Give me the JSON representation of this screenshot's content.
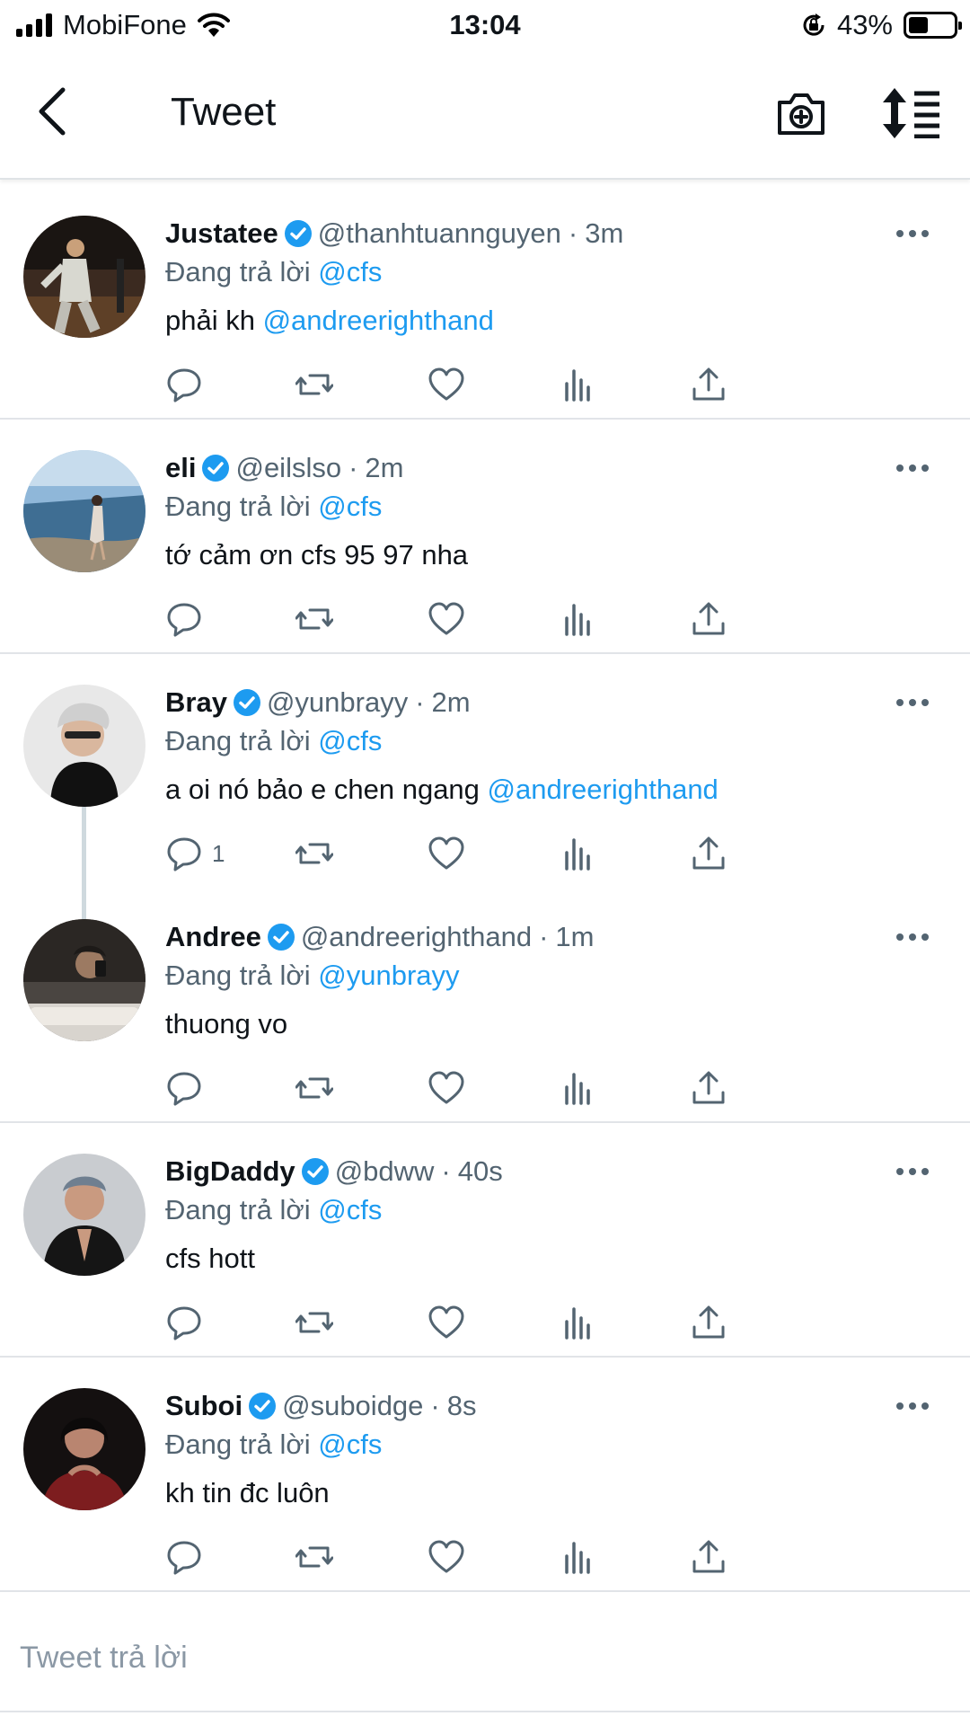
{
  "status_bar": {
    "carrier": "MobiFone",
    "time": "13:04",
    "battery": "43%",
    "battery_level": 0.43
  },
  "nav": {
    "title": "Tweet",
    "icons": {
      "back": "chevron-left-icon",
      "camera": "camera-plus-icon",
      "sort": "sort-icon"
    }
  },
  "colors": {
    "accent": "#1d9bf0",
    "text": "#0f1419",
    "muted": "#536471",
    "divider": "#e1e4e8"
  },
  "tweets": [
    {
      "name": "Justatee",
      "handle": "@thanhtuannguyen",
      "dot": "·",
      "time": "3m",
      "reply_prefix": "Đang trả lời",
      "reply_to": "@cfs",
      "text": "phải kh ",
      "text_mention": "@andreerighthand",
      "reply_count": ""
    },
    {
      "name": "eli",
      "handle": "@eilslso",
      "dot": "·",
      "time": "2m",
      "reply_prefix": "Đang trả lời",
      "reply_to": "@cfs",
      "text": "tớ cảm ơn cfs 95 97 nha",
      "text_mention": "",
      "reply_count": ""
    },
    {
      "name": "Bray",
      "handle": "@yunbrayy",
      "dot": "·",
      "time": "2m",
      "reply_prefix": "Đang trả lời",
      "reply_to": "@cfs",
      "text": "a oi nó bảo e chen ngang ",
      "text_mention": "@andreerighthand",
      "reply_count": "1"
    },
    {
      "name": "Andree",
      "handle": "@andreerighthand",
      "dot": "·",
      "time": "1m",
      "reply_prefix": "Đang trả lời",
      "reply_to": "@yunbrayy",
      "text": "thuong vo",
      "text_mention": "",
      "reply_count": ""
    },
    {
      "name": "BigDaddy",
      "handle": "@bdww",
      "dot": "·",
      "time": "40s",
      "reply_prefix": "Đang trả lời",
      "reply_to": "@cfs",
      "text": "cfs hott",
      "text_mention": "",
      "reply_count": ""
    },
    {
      "name": "Suboi",
      "handle": "@suboidge",
      "dot": "·",
      "time": "8s",
      "reply_prefix": "Đang trả lời",
      "reply_to": "@cfs",
      "text": "kh tin đc luôn",
      "text_mention": "",
      "reply_count": ""
    }
  ],
  "composer": {
    "placeholder": "Tweet trả lời"
  }
}
